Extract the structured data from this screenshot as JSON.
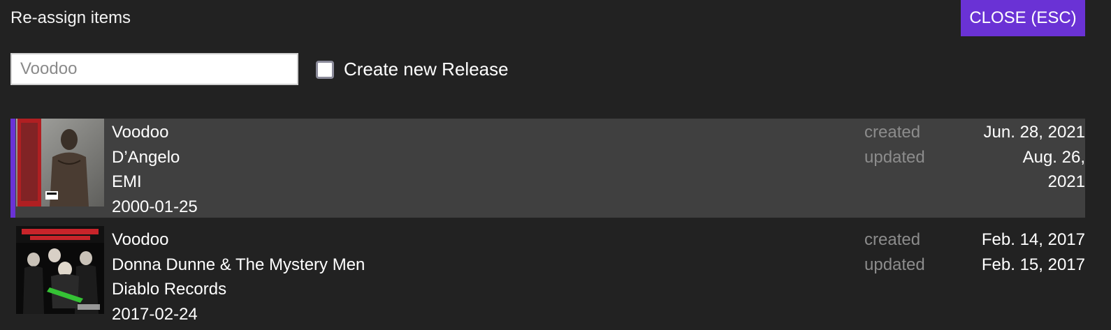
{
  "modal": {
    "title": "Re-assign items",
    "close_label": "CLOSE (ESC)"
  },
  "search": {
    "placeholder": "Voodoo"
  },
  "create_new": {
    "label": "Create new Release",
    "checked": false
  },
  "labels": {
    "created": "created",
    "updated": "updated"
  },
  "colors": {
    "accent": "#6a32d5",
    "background": "#222222",
    "selected_row": "#404040"
  },
  "releases": [
    {
      "title": "Voodoo",
      "artist": "D’Angelo",
      "label": "EMI",
      "date": "2000-01-25",
      "created": "Jun. 28, 2021",
      "updated_line1": "Aug. 26,",
      "updated_line2": "2021",
      "cover_icon": "album-cover-dangelo-voodoo",
      "selected": true
    },
    {
      "title": "Voodoo",
      "artist": "Donna Dunne & The Mystery Men",
      "label": "Diablo Records",
      "date": "2017-02-24",
      "created": "Feb. 14, 2017",
      "updated": "Feb. 15, 2017",
      "cover_icon": "album-cover-donna-dunne-voodoo",
      "selected": false
    }
  ]
}
